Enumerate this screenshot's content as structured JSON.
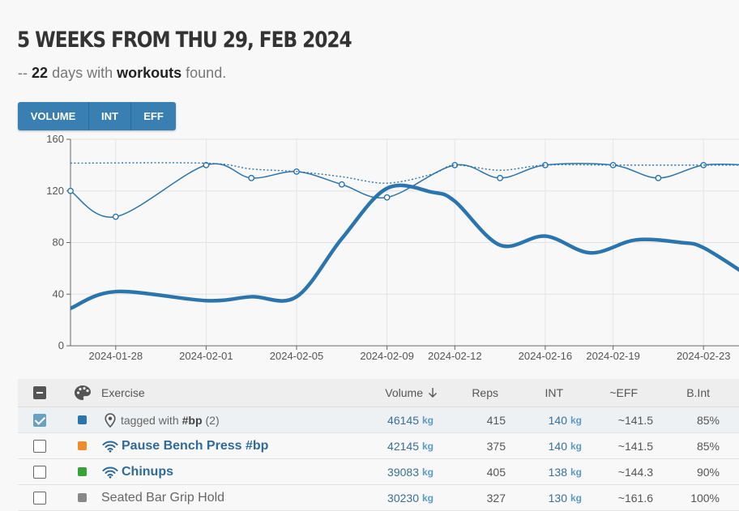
{
  "header": {
    "title": "5 WEEKS FROM THU 29, FEB 2024",
    "subtitle_prefix": "--",
    "days_count": "22",
    "days_text": "days with",
    "workouts_word": "workouts",
    "found_text": "found."
  },
  "toggle": {
    "volume": "VOLUME",
    "int": "INT",
    "eff": "EFF"
  },
  "chart_data": {
    "type": "line",
    "y_ticks": [
      "0",
      "40",
      "80",
      "120",
      "160"
    ],
    "ylim": [
      0,
      160
    ],
    "x_tick_labels": [
      "2024-01-28",
      "2024-02-01",
      "2024-02-05",
      "2024-02-09",
      "2024-02-12",
      "2024-02-16",
      "2024-02-19",
      "2024-02-23"
    ],
    "x_dates": [
      "2024-01-26",
      "2024-01-28",
      "2024-02-01",
      "2024-02-03",
      "2024-02-05",
      "2024-02-07",
      "2024-02-09",
      "2024-02-12",
      "2024-02-14",
      "2024-02-16",
      "2024-02-19",
      "2024-02-21",
      "2024-02-23",
      "2024-02-25"
    ],
    "series": [
      {
        "style": "thin-with-markers",
        "color": "#2a75ad",
        "points": [
          [
            "2024-01-26",
            120
          ],
          [
            "2024-01-28",
            100
          ],
          [
            "2024-02-01",
            140
          ],
          [
            "2024-02-03",
            130
          ],
          [
            "2024-02-05",
            135
          ],
          [
            "2024-02-07",
            125
          ],
          [
            "2024-02-09",
            115
          ],
          [
            "2024-02-12",
            140
          ],
          [
            "2024-02-14",
            130
          ],
          [
            "2024-02-16",
            140
          ],
          [
            "2024-02-19",
            140
          ],
          [
            "2024-02-21",
            130
          ],
          [
            "2024-02-23",
            140
          ],
          [
            "2024-02-25",
            140
          ]
        ]
      },
      {
        "style": "dotted",
        "color": "#2a75ad",
        "points": [
          [
            "2024-01-26",
            141.5
          ],
          [
            "2024-02-01",
            141.5
          ],
          [
            "2024-02-03",
            137
          ],
          [
            "2024-02-05",
            135
          ],
          [
            "2024-02-07",
            131
          ],
          [
            "2024-02-09",
            126
          ],
          [
            "2024-02-11",
            133
          ],
          [
            "2024-02-12",
            140
          ],
          [
            "2024-02-14",
            136
          ],
          [
            "2024-02-16",
            140
          ],
          [
            "2024-02-19",
            140
          ],
          [
            "2024-02-21",
            140
          ],
          [
            "2024-02-23",
            140
          ],
          [
            "2024-02-25",
            140
          ]
        ]
      },
      {
        "style": "thick",
        "color": "#2a75ad",
        "points": [
          [
            "2024-01-26",
            29
          ],
          [
            "2024-01-28",
            42
          ],
          [
            "2024-02-01",
            35
          ],
          [
            "2024-02-03",
            38
          ],
          [
            "2024-02-05",
            38
          ],
          [
            "2024-02-07",
            83
          ],
          [
            "2024-02-09",
            122
          ],
          [
            "2024-02-11",
            119
          ],
          [
            "2024-02-12",
            112
          ],
          [
            "2024-02-14",
            78
          ],
          [
            "2024-02-16",
            85
          ],
          [
            "2024-02-18",
            72
          ],
          [
            "2024-02-20",
            82
          ],
          [
            "2024-02-22",
            80
          ],
          [
            "2024-02-23",
            76
          ],
          [
            "2024-02-25",
            54
          ]
        ]
      }
    ]
  },
  "table": {
    "columns": {
      "exercise": "Exercise",
      "volume": "Volume",
      "reps": "Reps",
      "int": "INT",
      "eff": "~EFF",
      "bint": "B.Int"
    },
    "unit": "kg",
    "rows": [
      {
        "checked": true,
        "color": "#2a75ad",
        "icon": "map-pin-icon",
        "name_prefix": "tagged with",
        "tag": "#bp",
        "count": "(2)",
        "volume": "46145",
        "reps": "415",
        "int": "140",
        "eff": "~141.5",
        "bint": "85%"
      },
      {
        "checked": false,
        "color": "#f08c2a",
        "icon": "wifi-icon",
        "name": "Pause Bench Press #bp",
        "volume": "42145",
        "reps": "375",
        "int": "140",
        "eff": "~141.5",
        "bint": "85%"
      },
      {
        "checked": false,
        "color": "#36a336",
        "icon": "wifi-icon",
        "name": "Chinups",
        "volume": "39083",
        "reps": "405",
        "int": "138",
        "eff": "~144.3",
        "bint": "90%"
      },
      {
        "checked": false,
        "color": "#888888",
        "icon": "",
        "name": "Seated Bar Grip Hold",
        "volume": "30230",
        "reps": "327",
        "int": "130",
        "eff": "~161.6",
        "bint": "100%"
      }
    ]
  }
}
